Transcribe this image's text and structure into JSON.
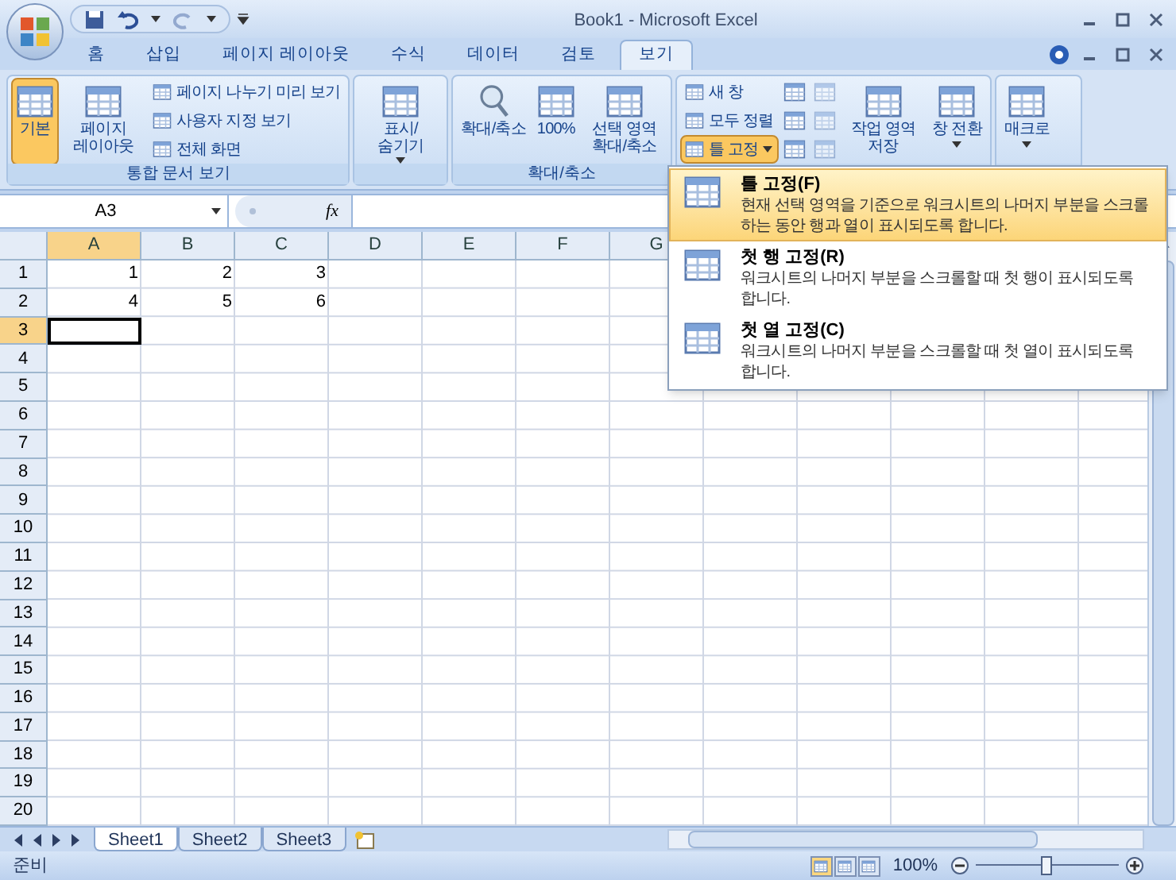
{
  "window": {
    "title": "Book1 - Microsoft Excel"
  },
  "tabs": [
    {
      "label": "홈",
      "selected": false
    },
    {
      "label": "삽입",
      "selected": false
    },
    {
      "label": "페이지 레이아웃",
      "selected": false
    },
    {
      "label": "수식",
      "selected": false
    },
    {
      "label": "데이터",
      "selected": false
    },
    {
      "label": "검토",
      "selected": false
    },
    {
      "label": "보기",
      "selected": true
    }
  ],
  "ribbon": {
    "groups": [
      {
        "label": "통합 문서 보기",
        "items": [
          {
            "kind": "large",
            "label": "기본",
            "selected": true
          },
          {
            "kind": "large",
            "label": "페이지 레이아웃",
            "selected": false
          },
          {
            "kind": "stack",
            "items": [
              {
                "kind": "small",
                "label": "페이지 나누기 미리 보기",
                "selected": false
              },
              {
                "kind": "small",
                "label": "사용자 지정 보기",
                "selected": false
              },
              {
                "kind": "small",
                "label": "전체 화면",
                "selected": false
              }
            ]
          }
        ]
      },
      {
        "items": [
          {
            "kind": "large",
            "label": "표시/숨기기",
            "selected": false,
            "dropdown": true
          }
        ]
      },
      {
        "label": "확대/축소",
        "items": [
          {
            "kind": "large",
            "label": "확대/축소",
            "selected": false
          },
          {
            "kind": "large",
            "label": "100%",
            "selected": false
          },
          {
            "kind": "large",
            "label": "선택 영역 확대/축소",
            "selected": false
          }
        ]
      },
      {
        "items": [
          {
            "kind": "stack",
            "items": [
              {
                "kind": "small",
                "label": "새 창",
                "selected": false
              },
              {
                "kind": "small",
                "label": "모두 정렬",
                "selected": false
              },
              {
                "kind": "small",
                "label": "틀 고정",
                "selected": true,
                "dropdown": true
              }
            ]
          },
          {
            "kind": "stack",
            "items": [
              {
                "kind": "icon",
                "disabled": false
              },
              {
                "kind": "icon",
                "disabled": false
              },
              {
                "kind": "icon",
                "disabled": false
              }
            ]
          },
          {
            "kind": "stack",
            "items": [
              {
                "kind": "icon",
                "disabled": true
              },
              {
                "kind": "icon",
                "disabled": true
              },
              {
                "kind": "icon",
                "disabled": true
              }
            ]
          },
          {
            "kind": "large",
            "label": "작업 영역 저장",
            "selected": false
          },
          {
            "kind": "large",
            "label": "창 전환",
            "selected": false,
            "dropdown": true
          }
        ]
      },
      {
        "items": [
          {
            "kind": "large",
            "label": "매크로",
            "selected": false,
            "dropdown": true
          }
        ]
      }
    ]
  },
  "formula_bar": {
    "name_box": "A3",
    "function_label": "fx"
  },
  "grid": {
    "columns": [
      {
        "label": "A",
        "selected": true
      },
      {
        "label": "B",
        "selected": false
      },
      {
        "label": "C",
        "selected": false
      },
      {
        "label": "D",
        "selected": false
      },
      {
        "label": "E",
        "selected": false
      },
      {
        "label": "F",
        "selected": false
      },
      {
        "label": "G",
        "selected": false
      }
    ],
    "rows": [
      {
        "label": "1",
        "selected": false,
        "cells": [
          "1",
          "2",
          "3"
        ]
      },
      {
        "label": "2",
        "selected": false,
        "cells": [
          "4",
          "5",
          "6"
        ]
      },
      {
        "label": "3",
        "selected": true
      },
      {
        "label": "4",
        "selected": false
      },
      {
        "label": "5",
        "selected": false
      },
      {
        "label": "6",
        "selected": false
      },
      {
        "label": "7",
        "selected": false
      },
      {
        "label": "8",
        "selected": false
      },
      {
        "label": "9",
        "selected": false
      },
      {
        "label": "10",
        "selected": false
      },
      {
        "label": "11",
        "selected": false
      },
      {
        "label": "12",
        "selected": false
      },
      {
        "label": "13",
        "selected": false
      },
      {
        "label": "14",
        "selected": false
      },
      {
        "label": "15",
        "selected": false
      },
      {
        "label": "16",
        "selected": false
      },
      {
        "label": "17",
        "selected": false
      },
      {
        "label": "18",
        "selected": false
      },
      {
        "label": "19",
        "selected": false
      },
      {
        "label": "20",
        "selected": false
      }
    ]
  },
  "freeze_menu": [
    {
      "title": "틀 고정(F)",
      "description": "현재 선택 영역을 기준으로 워크시트의 나머지 부분을 스크롤하는 동안 행과 열이 표시되도록 합니다.",
      "selected": true
    },
    {
      "title": "첫 행 고정(R)",
      "description": "워크시트의 나머지 부분을 스크롤할 때 첫 행이 표시되도록 합니다.",
      "selected": false
    },
    {
      "title": "첫 열 고정(C)",
      "description": "워크시트의 나머지 부분을 스크롤할 때 첫 열이 표시되도록 합니다.",
      "selected": false
    }
  ],
  "sheet_tabs": [
    {
      "label": "Sheet1",
      "selected": true
    },
    {
      "label": "Sheet2",
      "selected": false
    },
    {
      "label": "Sheet3",
      "selected": false
    }
  ],
  "status_bar": {
    "status": "준비",
    "views": [
      {
        "selected": true
      },
      {
        "selected": false
      },
      {
        "selected": false
      }
    ],
    "zoom": "100%",
    "zoom_slider": {
      "level": 0.5
    }
  }
}
